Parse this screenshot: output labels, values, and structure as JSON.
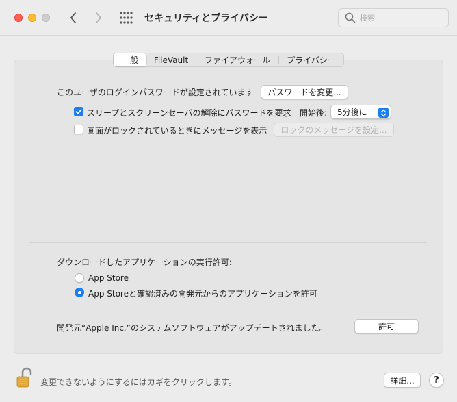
{
  "window": {
    "title": "セキュリティとプライバシー",
    "search_placeholder": "検索"
  },
  "tabs": [
    {
      "label": "一般",
      "selected": true
    },
    {
      "label": "FileVault",
      "selected": false
    },
    {
      "label": "ファイアウォール",
      "selected": false
    },
    {
      "label": "プライバシー",
      "selected": false
    }
  ],
  "general": {
    "password_set_text": "このユーザのログインパスワードが設定されています",
    "change_password_button": "パスワードを変更...",
    "require_password": {
      "label": "スリープとスクリーンセーバの解除にパスワードを要求",
      "checked": true,
      "after_label": "開始後:",
      "after_value": "5分後に"
    },
    "show_message": {
      "label": "画面がロックされているときにメッセージを表示",
      "checked": false,
      "button": "ロックのメッセージを設定..."
    },
    "download_heading": "ダウンロードしたアプリケーションの実行許可:",
    "download_options": [
      {
        "label": "App Store",
        "selected": false
      },
      {
        "label": "App Storeと確認済みの開発元からのアプリケーションを許可",
        "selected": true
      }
    ],
    "blocked_software_text": "開発元“Apple Inc.”のシステムソフトウェアがアップデートされました。",
    "allow_button": "許可"
  },
  "footer": {
    "lock_text": "変更できないようにするにはカギをクリックします。",
    "advanced_button": "詳細...",
    "help_button": "?"
  },
  "colors": {
    "accent": "#1a7ef3",
    "window_bg": "#ececec",
    "panel_bg": "#e5e5e5",
    "lock_gold": "#e0a93a"
  }
}
